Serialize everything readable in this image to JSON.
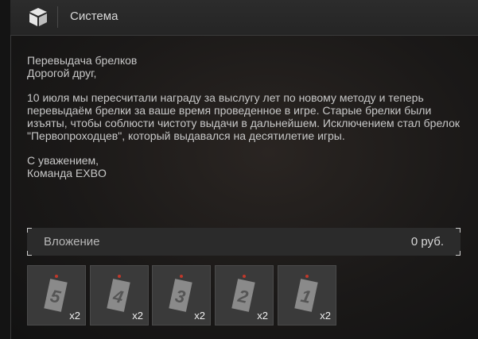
{
  "header": {
    "sender": "Система",
    "icon": "box-icon"
  },
  "message": {
    "title": "Перевыдача брелков",
    "greeting": "Дорогой друг,",
    "paragraph": "10 июля мы пересчитали награду за выслугу лет по новому методу и теперь перевыдаём брелки за ваше время проведенное в игре. Старые брелки были изъяты, чтобы соблюсти чистоту выдачи в дальнейшем. Исключением стал брелок \"Первопроходцев\", который выдавался на десятилетие игры.",
    "signoff": "С уважением,",
    "signature": "Команда EXBO"
  },
  "attachment": {
    "label": "Вложение",
    "value": "0 руб."
  },
  "items": [
    {
      "number": "5",
      "qty": "x2"
    },
    {
      "number": "4",
      "qty": "x2"
    },
    {
      "number": "3",
      "qty": "x2"
    },
    {
      "number": "2",
      "qty": "x2"
    },
    {
      "number": "1",
      "qty": "x2"
    }
  ],
  "colors": {
    "accent_dot": "#c0392b",
    "tag": "#8a8a8a"
  }
}
